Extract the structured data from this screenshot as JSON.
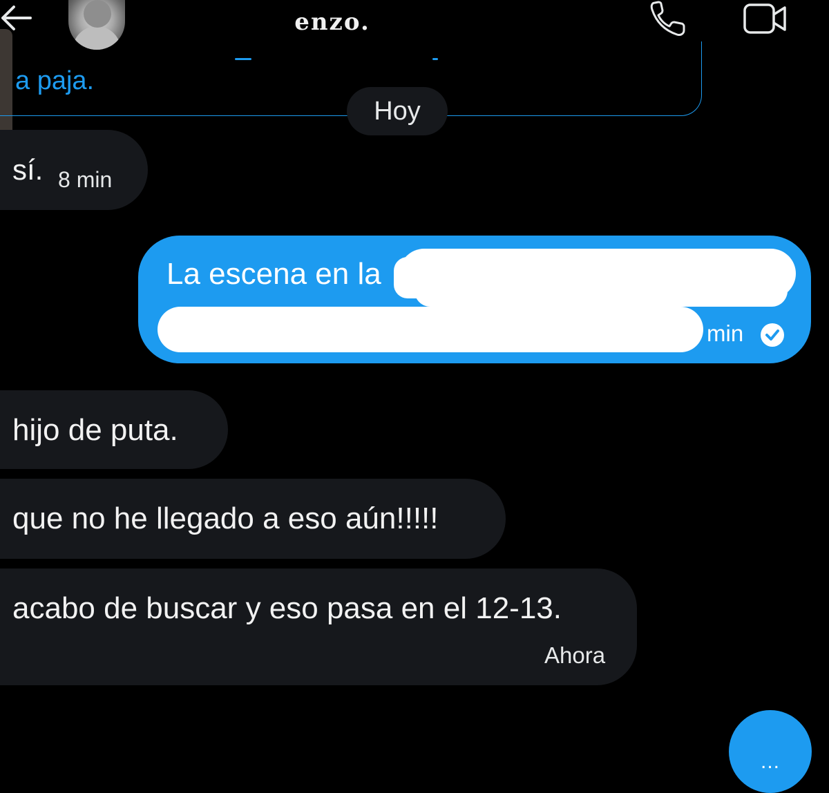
{
  "header": {
    "name": "enzo.",
    "icons": [
      "back-arrow-icon",
      "avatar",
      "phone-icon",
      "video-icon"
    ]
  },
  "quoted": {
    "text": "a paja."
  },
  "date_separator": "Hoy",
  "messages": [
    {
      "direction": "in",
      "text": "sí.",
      "time": "8 min"
    },
    {
      "direction": "out",
      "text": "La escena en la",
      "time": "min",
      "status_icon": "check-circle-icon"
    },
    {
      "direction": "in",
      "text": "hijo de puta."
    },
    {
      "direction": "in",
      "text": "que no he llegado a eso aún!!!!!"
    },
    {
      "direction": "in",
      "text": "acabo de buscar y eso pasa en el 12-13.",
      "time": "Ahora"
    }
  ],
  "fab": {
    "label": "..."
  },
  "colors": {
    "background": "#000000",
    "accent": "#1d9bf0",
    "incoming_bubble": "#16181c"
  }
}
